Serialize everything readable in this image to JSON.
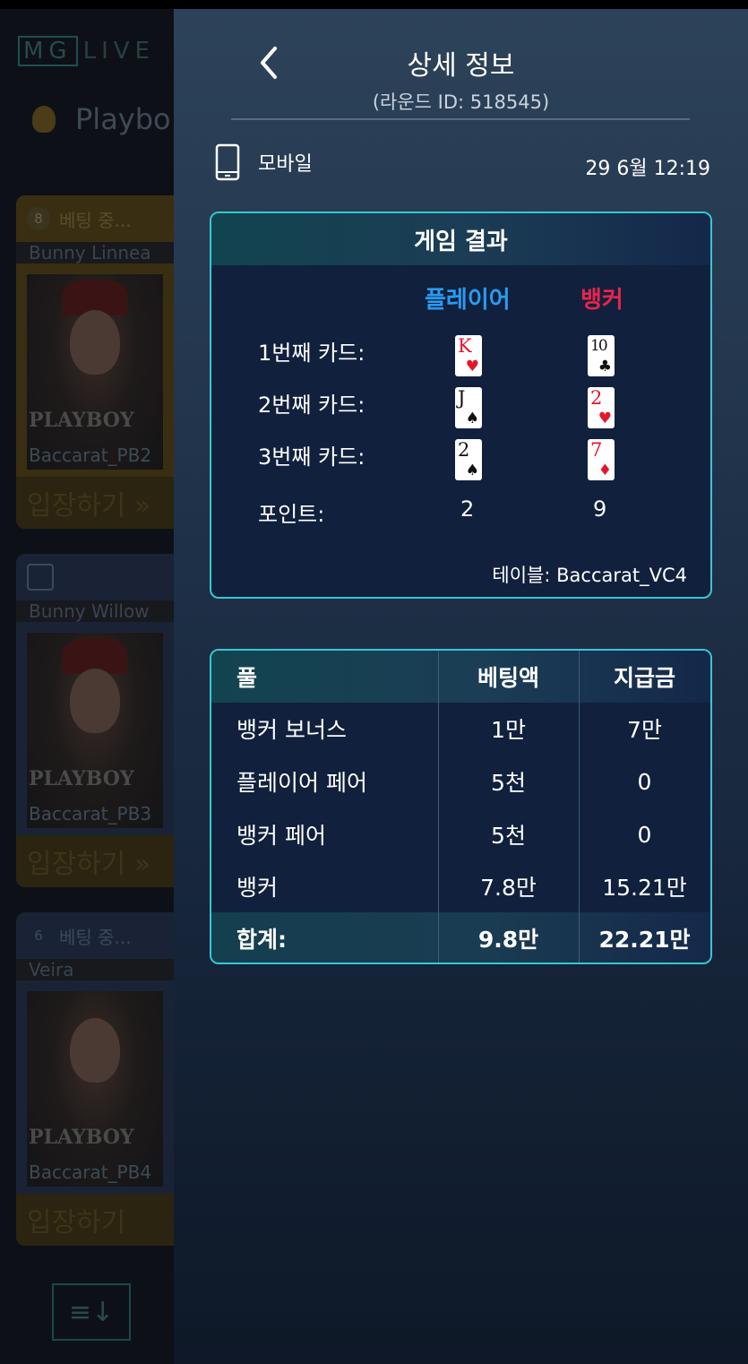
{
  "background": {
    "logo": {
      "box_text": "MG",
      "text": "LIVE"
    },
    "brand": "Playbo",
    "tiles": [
      {
        "count": "8",
        "status": "베팅 중...",
        "dealer": "Bunny Linnea",
        "watermark": "PLAYBOY",
        "table": "Baccarat_PB2",
        "enter": "입장하기 »"
      },
      {
        "count": "",
        "status": "",
        "dealer": "Bunny Willow",
        "watermark": "PLAYBOY",
        "table": "Baccarat_PB3",
        "enter": "입장하기 »"
      },
      {
        "count": "6",
        "status": "베팅 중...",
        "dealer": "Veira",
        "watermark": "PLAYBOY",
        "table": "Baccarat_PB4",
        "enter": "입장하기"
      }
    ]
  },
  "header": {
    "title": "상세 정보",
    "round_id": "(라운드 ID: 518545)"
  },
  "meta": {
    "device": "모바일",
    "datetime": "29  6월 12:19"
  },
  "game_result": {
    "title": "게임 결과",
    "player_label": "플레이어",
    "banker_label": "뱅커",
    "rows": [
      {
        "label": "1번째  카드:",
        "player": {
          "rank": "K",
          "suit": "♥",
          "color": "red"
        },
        "banker": {
          "rank": "10",
          "suit": "♣",
          "color": "black"
        }
      },
      {
        "label": "2번째 카드:",
        "player": {
          "rank": "J",
          "suit": "♠",
          "color": "black"
        },
        "banker": {
          "rank": "2",
          "suit": "♥",
          "color": "red"
        }
      },
      {
        "label": "3번째 카드:",
        "player": {
          "rank": "2",
          "suit": "♠",
          "color": "black"
        },
        "banker": {
          "rank": "7",
          "suit": "♦",
          "color": "red"
        }
      }
    ],
    "points_label": "포인트:",
    "player_points": "2",
    "banker_points": "9",
    "table": "테이블: Baccarat_VC4"
  },
  "bets": {
    "headers": [
      "풀",
      "베팅액",
      "지급금"
    ],
    "rows": [
      [
        "뱅커 보너스",
        "1만",
        "7만"
      ],
      [
        "플레이어 페어",
        "5천",
        "0"
      ],
      [
        "뱅커 페어",
        "5천",
        "0"
      ],
      [
        "뱅커",
        "7.8만",
        "15.21만"
      ]
    ],
    "total": [
      "합계:",
      "9.8만",
      "22.21만"
    ]
  },
  "colors": {
    "accent_border": "#37c7d4",
    "player": "#2a9bf0",
    "banker": "#e8244d"
  }
}
